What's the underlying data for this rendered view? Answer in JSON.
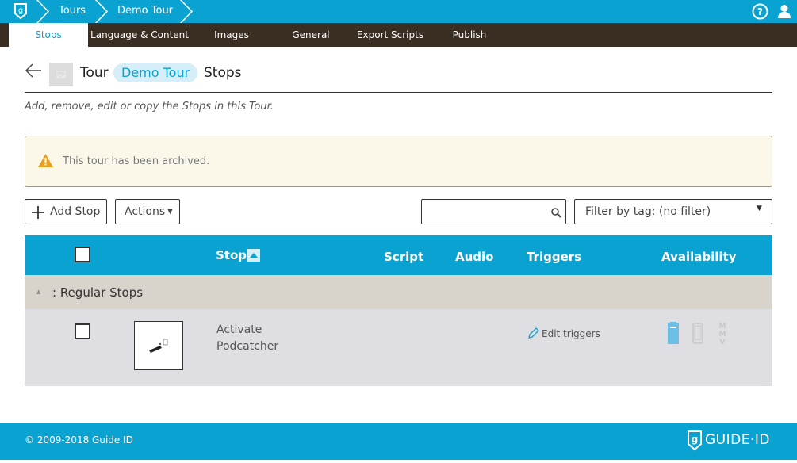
{
  "topbar": {
    "crumbs": [
      "Tours",
      "Demo Tour"
    ]
  },
  "tabs": [
    "Stops",
    "Language & Content",
    "Images",
    "General",
    "Export Scripts",
    "Publish"
  ],
  "header": {
    "prefix": "Tour",
    "tour_name": "Demo Tour",
    "suffix": "Stops",
    "subtitle": "Add, remove, edit or copy the Stops in this Tour."
  },
  "alert": {
    "message": "This tour has been archived."
  },
  "toolbar": {
    "add_stop": "Add Stop",
    "actions": "Actions",
    "search_value": "",
    "filter_label": "Filter by tag: (no filter)"
  },
  "table": {
    "columns": [
      "Stop",
      "Script",
      "Audio",
      "Triggers",
      "Availability"
    ],
    "group": ": Regular Stops",
    "rows": [
      {
        "name": "Activate Podcatcher",
        "triggers": "Edit triggers",
        "availability": [
          "kiosk",
          "phone",
          "MMV"
        ]
      }
    ]
  },
  "footer": {
    "copyright": "© 2009-2018 Guide ID",
    "brand": "GUIDE·ID"
  },
  "colors": {
    "brand_blue": "#0aa2d0",
    "tab_bar": "#3a2e22",
    "alert_bg": "#fcf8e9",
    "warning": "#e6a01e"
  }
}
